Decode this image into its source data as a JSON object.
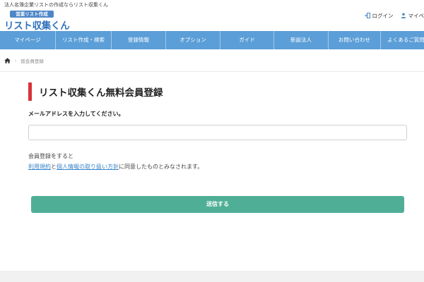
{
  "header": {
    "tagline": "法人名簿企業リストの作成ならリスト収集くん",
    "logo": {
      "badge": "営業リスト作成",
      "main": "リスト収集くん"
    },
    "links": [
      {
        "label": "ログイン",
        "icon": "login-icon"
      },
      {
        "label": "マイペ",
        "icon": "user-icon"
      }
    ]
  },
  "nav": {
    "items": [
      {
        "label": "マイページ"
      },
      {
        "label": "リスト作成・検索"
      },
      {
        "label": "登録情報"
      },
      {
        "label": "オプション"
      },
      {
        "label": "ガイド"
      },
      {
        "label": "新設法人"
      },
      {
        "label": "お問い合わせ"
      },
      {
        "label": "よくあるご質問"
      }
    ]
  },
  "breadcrumb": {
    "home_icon": "home-icon",
    "current": "仮会員登録"
  },
  "main": {
    "title": "リスト収集くん無料会員登録",
    "email_label": "メールアドレスを入力してください。",
    "email_value": "",
    "email_placeholder": "",
    "note_line1": "会員登録をすると",
    "terms_link": "利用規約",
    "and_text": "と",
    "privacy_link": "個人情報の取り扱い方針",
    "note_suffix": "に同意したものとみなされます。",
    "submit_label": "送信する"
  },
  "colors": {
    "nav_bg": "#5b9ed8",
    "title_accent": "#d8333a",
    "submit_bg": "#4faf96",
    "link": "#3a86c8",
    "logo": "#2f72bc"
  }
}
